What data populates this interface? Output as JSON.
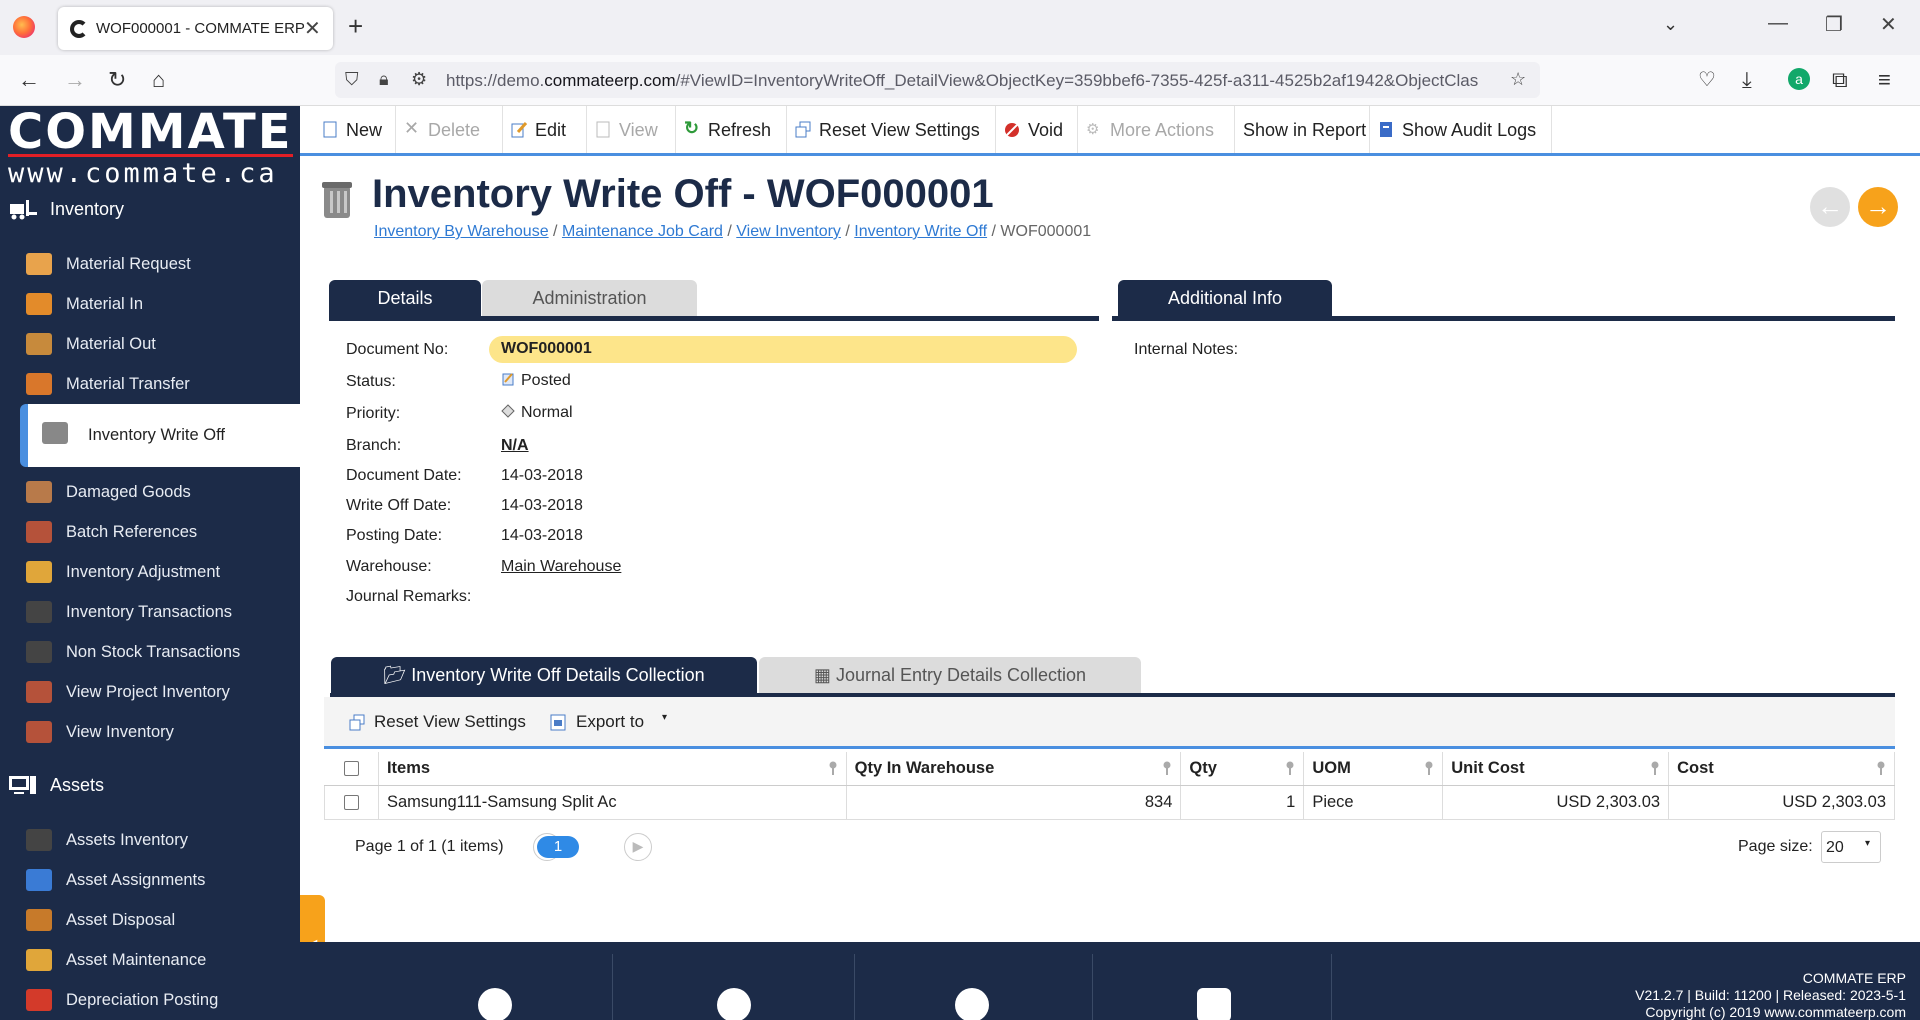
{
  "browser": {
    "tab_title": "WOF000001 - COMMATE ERP",
    "url_prefix": "https://demo.",
    "url_domain": "commateerp.com",
    "url_rest": "/#ViewID=InventoryWriteOff_DetailView&ObjectKey=359bbef6-7355-425f-a311-4525b2af1942&ObjectClas"
  },
  "brand": {
    "name": "COMMATE",
    "url": "www.commate.ca"
  },
  "sidebar": {
    "group_inventory": "Inventory",
    "items": [
      {
        "label": "Material Request",
        "color": "#e8a34c"
      },
      {
        "label": "Material In",
        "color": "#e38b2a"
      },
      {
        "label": "Material Out",
        "color": "#c78a3c"
      },
      {
        "label": "Material Transfer",
        "color": "#d9772b"
      },
      {
        "label": "Inventory Write Off",
        "color": "#888888"
      },
      {
        "label": "Damaged Goods",
        "color": "#b87a4a"
      },
      {
        "label": "Batch References",
        "color": "#b5523a"
      },
      {
        "label": "Inventory Adjustment",
        "color": "#e0a63a"
      },
      {
        "label": "Inventory Transactions",
        "color": "#444444"
      },
      {
        "label": "Non Stock Transactions",
        "color": "#444444"
      },
      {
        "label": "View Project Inventory",
        "color": "#b5523a"
      },
      {
        "label": "View Inventory",
        "color": "#b5523a"
      }
    ],
    "group_assets": "Assets",
    "asset_items": [
      {
        "label": "Assets Inventory",
        "color": "#444444"
      },
      {
        "label": "Asset Assignments",
        "color": "#3a7bd5"
      },
      {
        "label": "Asset Disposal",
        "color": "#c77a2a"
      },
      {
        "label": "Asset Maintenance",
        "color": "#e0a63a"
      },
      {
        "label": "Depreciation Posting",
        "color": "#d33a2a"
      }
    ]
  },
  "toolbar": {
    "new": "New",
    "delete": "Delete",
    "edit": "Edit",
    "view": "View",
    "refresh": "Refresh",
    "reset": "Reset View Settings",
    "void": "Void",
    "more": "More Actions",
    "report": "Show in Report",
    "audit": "Show Audit Logs"
  },
  "header": {
    "title": "Inventory Write Off - WOF000001",
    "breadcrumb": [
      "Inventory By Warehouse",
      "Maintenance Job Card",
      "View Inventory",
      "Inventory Write Off"
    ],
    "breadcrumb_current": "WOF000001"
  },
  "tabs": {
    "details": "Details",
    "administration": "Administration",
    "additional": "Additional Info"
  },
  "fields": {
    "document_no_label": "Document No:",
    "document_no": "WOF000001",
    "status_label": "Status:",
    "status": "Posted",
    "priority_label": "Priority:",
    "priority": "Normal",
    "branch_label": "Branch:",
    "branch": "N/A",
    "document_date_label": "Document Date:",
    "document_date": "14-03-2018",
    "write_off_date_label": "Write Off Date:",
    "write_off_date": "14-03-2018",
    "posting_date_label": "Posting Date:",
    "posting_date": "14-03-2018",
    "warehouse_label": "Warehouse:",
    "warehouse": "Main Warehouse",
    "journal_remarks_label": "Journal Remarks:",
    "internal_notes_label": "Internal Notes:"
  },
  "collections": {
    "tab_details": "Inventory Write Off Details Collection",
    "tab_journal": "Journal Entry Details Collection",
    "reset": "Reset View Settings",
    "export": "Export to"
  },
  "grid": {
    "columns": [
      "Items",
      "Qty In Warehouse",
      "Qty",
      "UOM",
      "Unit Cost",
      "Cost"
    ],
    "rows": [
      {
        "item": "Samsung111-Samsung Split Ac",
        "qty_wh": "834",
        "qty": "1",
        "uom": "Piece",
        "unit_cost": "USD 2,303.03",
        "cost": "USD 2,303.03"
      }
    ]
  },
  "pager": {
    "summary": "Page 1 of 1 (1 items)",
    "current": "1",
    "size_label": "Page size:",
    "size": "20"
  },
  "footer": {
    "app": "COMMATE ERP",
    "version": "V21.2.7 | Build: 11200 | Released: 2023-5-1",
    "copyright": "Copyright (c) 2019 www.commateerp.com"
  }
}
